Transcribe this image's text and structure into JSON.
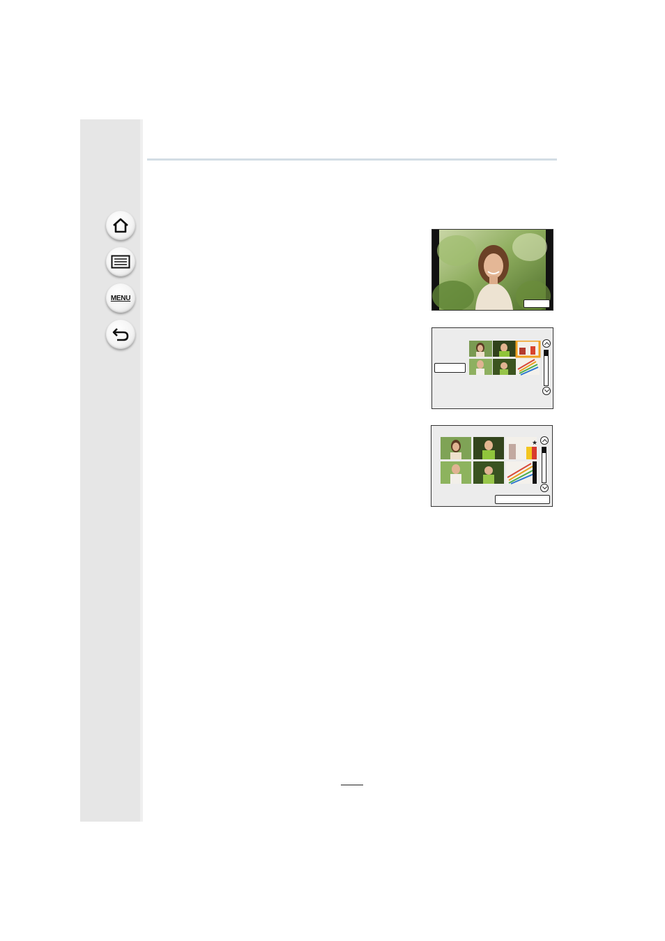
{
  "sidebar": {
    "buttons": [
      {
        "id": "home",
        "icon": "home-icon"
      },
      {
        "id": "contents",
        "icon": "list-icon"
      },
      {
        "id": "menu",
        "icon": "menu-icon",
        "label": "MENU"
      },
      {
        "id": "back",
        "icon": "back-arrow-icon"
      }
    ]
  },
  "colors": {
    "sidebar": "#e6e6e6",
    "rule": "#d3dde5",
    "selection": "#f0a020"
  },
  "page": {
    "number": ""
  }
}
